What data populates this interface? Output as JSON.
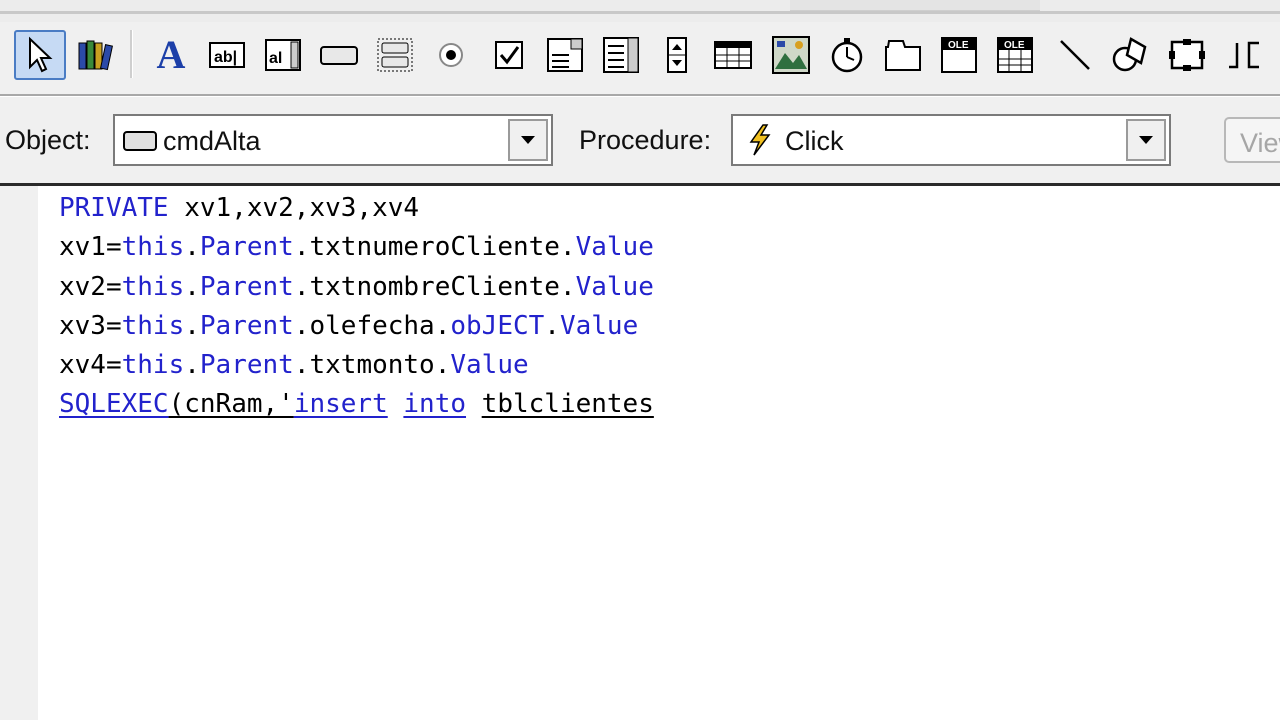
{
  "toolbar": {
    "tools": [
      {
        "icon": "pointer-icon"
      },
      {
        "icon": "class-library-icon"
      },
      {
        "icon": "label-tool-icon",
        "glyph": "A"
      },
      {
        "icon": "textbox-tool-icon"
      },
      {
        "icon": "editbox-tool-icon"
      },
      {
        "icon": "command-button-tool-icon"
      },
      {
        "icon": "command-group-tool-icon"
      },
      {
        "icon": "option-group-tool-icon"
      },
      {
        "icon": "checkbox-tool-icon"
      },
      {
        "icon": "combobox-tool-icon"
      },
      {
        "icon": "listbox-tool-icon"
      },
      {
        "icon": "spinner-tool-icon"
      },
      {
        "icon": "grid-tool-icon"
      },
      {
        "icon": "image-tool-icon"
      },
      {
        "icon": "timer-tool-icon"
      },
      {
        "icon": "pageframe-tool-icon"
      },
      {
        "icon": "ole-container-tool-icon",
        "text": "OLE"
      },
      {
        "icon": "ole-bound-tool-icon",
        "text": "OLE"
      },
      {
        "icon": "line-tool-icon"
      },
      {
        "icon": "shape-tool-icon"
      },
      {
        "icon": "container-tool-icon"
      },
      {
        "icon": "separator-tool-icon"
      }
    ]
  },
  "selectors": {
    "object_label": "Object:",
    "object_value": "cmdAlta",
    "procedure_label": "Procedure:",
    "procedure_value": "Click",
    "view_button": "View"
  },
  "code": {
    "lines": [
      [
        {
          "t": "PRIVATE",
          "c": "kw"
        },
        {
          "t": " xv1,xv2,xv3,xv4",
          "c": ""
        }
      ],
      [
        {
          "t": "xv1=",
          "c": ""
        },
        {
          "t": "this",
          "c": "kw"
        },
        {
          "t": ".",
          "c": ""
        },
        {
          "t": "Parent",
          "c": "kw"
        },
        {
          "t": ".txtnumeroCliente.",
          "c": ""
        },
        {
          "t": "Value",
          "c": "kw"
        }
      ],
      [
        {
          "t": "xv2=",
          "c": ""
        },
        {
          "t": "this",
          "c": "kw"
        },
        {
          "t": ".",
          "c": ""
        },
        {
          "t": "Parent",
          "c": "kw"
        },
        {
          "t": ".txtnombreCliente.",
          "c": ""
        },
        {
          "t": "Value",
          "c": "kw"
        }
      ],
      [
        {
          "t": "xv3=",
          "c": ""
        },
        {
          "t": "this",
          "c": "kw"
        },
        {
          "t": ".",
          "c": ""
        },
        {
          "t": "Parent",
          "c": "kw"
        },
        {
          "t": ".olefecha.",
          "c": ""
        },
        {
          "t": "obJECT",
          "c": "kw"
        },
        {
          "t": ".",
          "c": ""
        },
        {
          "t": "Value",
          "c": "kw"
        }
      ],
      [
        {
          "t": "xv4=",
          "c": ""
        },
        {
          "t": "this",
          "c": "kw"
        },
        {
          "t": ".",
          "c": ""
        },
        {
          "t": "Parent",
          "c": "kw"
        },
        {
          "t": ".txtmonto.",
          "c": ""
        },
        {
          "t": "Value",
          "c": "kw"
        }
      ],
      [
        {
          "t": "SQLEXEC",
          "c": "sqkw"
        },
        {
          "t": "(cnRam,'",
          "c": "sq"
        },
        {
          "t": "insert",
          "c": "sqkw"
        },
        {
          "t": " ",
          "c": ""
        },
        {
          "t": "into",
          "c": "sqkw"
        },
        {
          "t": " ",
          "c": ""
        },
        {
          "t": "tblclientes",
          "c": "sq"
        }
      ]
    ]
  },
  "colors": {
    "keyword": "#2222cc",
    "selection_border": "#4a7cc4",
    "selection_fill": "#c6daf4"
  }
}
